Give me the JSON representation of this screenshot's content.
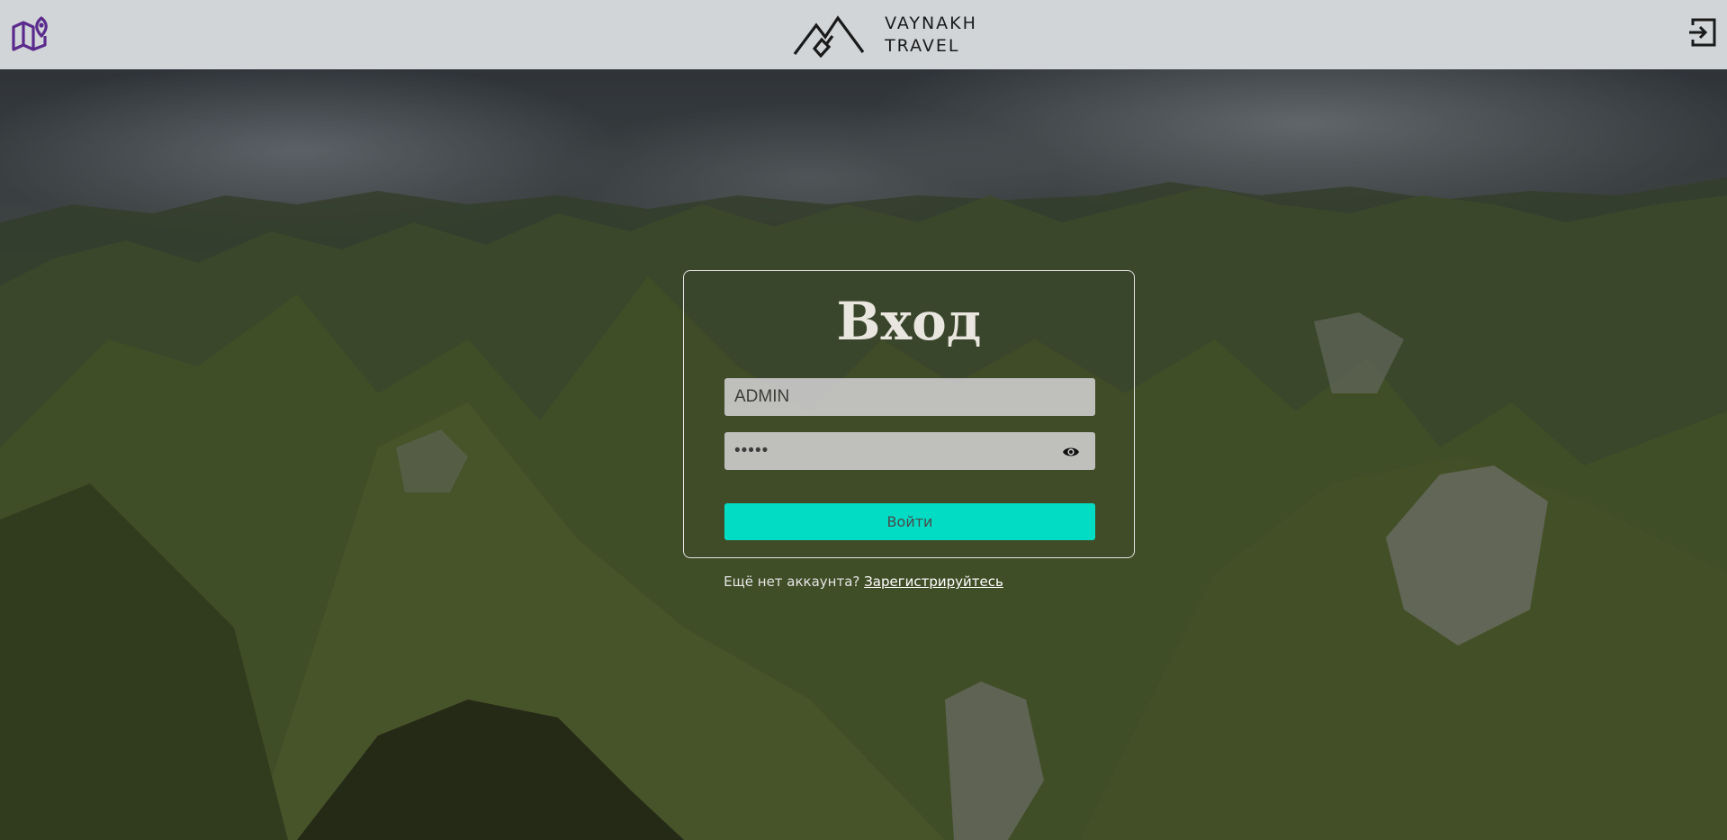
{
  "header": {
    "logo_line1": "VAYNAKH",
    "logo_line2": "TRAVEL",
    "map_icon": "map-pin-icon",
    "logout_icon": "login-enter-icon"
  },
  "login": {
    "title": "Вход",
    "username_value": "ADMIN",
    "password_value": "•••••",
    "submit_label": "Войти",
    "show_password_icon": "eye-icon"
  },
  "footer": {
    "prompt": "Ещё нет аккаунта?",
    "register_link": "Зарегистрируйтесь"
  },
  "colors": {
    "accent": "#03dcc5",
    "header_bg": "#d1d5d8",
    "map_icon": "#5a2a8c"
  }
}
